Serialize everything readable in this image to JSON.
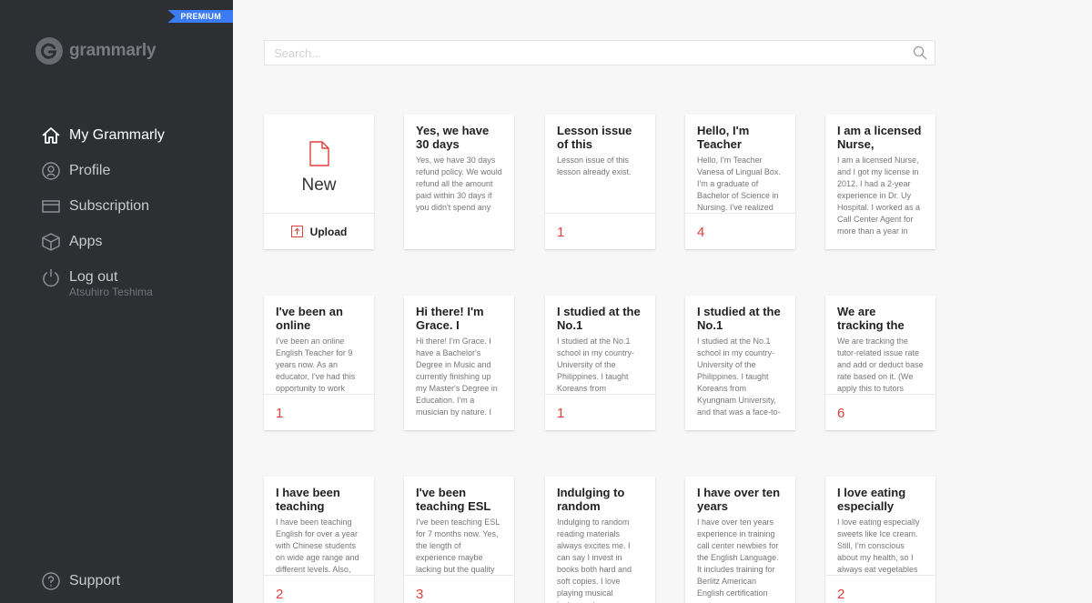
{
  "sidebar": {
    "badge": "PREMIUM",
    "logo_text": "grammarly",
    "nav": [
      {
        "label": "My Grammarly",
        "icon": "home-icon"
      },
      {
        "label": "Profile",
        "icon": "profile-icon"
      },
      {
        "label": "Subscription",
        "icon": "credit-card-icon"
      },
      {
        "label": "Apps",
        "icon": "box-icon"
      },
      {
        "label": "Log out",
        "icon": "power-icon"
      }
    ],
    "user_name": "Atsuhiro Teshima",
    "support_label": "Support"
  },
  "search": {
    "placeholder": "Search..."
  },
  "new_card": {
    "label": "New",
    "upload_label": "Upload"
  },
  "documents": [
    {
      "title": "Yes, we have 30 days",
      "preview": "Yes, we have 30 days refund policy. We would refund all the amount paid within 30 days if you didn't spend any ticket.",
      "count": ""
    },
    {
      "title": "Lesson issue of this",
      "preview": "Lesson issue of this lesson already exist.",
      "count": "1"
    },
    {
      "title": "Hello, I'm Teacher",
      "preview": "Hello, I'm Teacher Vanesa of Lingual Box. I'm a graduate of Bachelor of Science in Nursing. I've realized",
      "count": "4"
    },
    {
      "title": "I am a licensed Nurse,",
      "preview": "I am a licensed Nurse, and I got my license in 2012. I had a 2-year experience in Dr. Uy Hospital. I worked as a Call Center Agent for more than a year in",
      "count": ""
    },
    {
      "title": "I've been an online",
      "preview": "I've been an online English Teacher for 9 years now. As an educator, I've had this opportunity to work",
      "count": "1"
    },
    {
      "title": "Hi there! I'm Grace. I",
      "preview": "Hi there! I'm Grace. I have a Bachelor's Degree in Music and currently finishing up my Master's Degree in Education. I'm a musician by nature. I",
      "count": ""
    },
    {
      "title": "I studied at the No.1",
      "preview": "I studied at the No.1 school in my country- University of the Philippines. I taught Koreans from",
      "count": "1"
    },
    {
      "title": "I studied at the No.1",
      "preview": "I studied at the No.1 school in my country- University of the Philippines. I taught Koreans from Kyungnam University, and that was a face-to-",
      "count": ""
    },
    {
      "title": "We are tracking the",
      "preview": "We are tracking the tutor-related issue rate and add or deduct base rate based on it. (We apply this to tutors",
      "count": "6"
    },
    {
      "title": "I have been teaching",
      "preview": "I have been teaching English for over a year with Chinese students on wide age range and different levels. Also,",
      "count": "2"
    },
    {
      "title": "I've been teaching ESL",
      "preview": "I've been teaching ESL for 7 months now. Yes, the length of experience maybe lacking but the quality",
      "count": "3"
    },
    {
      "title": "Indulging to random",
      "preview": "Indulging to random reading materials always excites me. I can say I invest in books both hard and soft copies. I love playing musical instruments",
      "count": ""
    },
    {
      "title": "I have over ten years",
      "preview": "I have over ten years experience in training call center newbies for the English Language. It includes training for Berlitz American English certification",
      "count": ""
    },
    {
      "title": "I love eating especially",
      "preview": "I love eating especially sweets like Ice cream. Still, I'm conscious about my health, so I always eat vegetables",
      "count": "2"
    }
  ],
  "colors": {
    "sidebar_bg": "#2e2f33",
    "premium": "#3b7cf5",
    "accent_red": "#e0403a"
  }
}
